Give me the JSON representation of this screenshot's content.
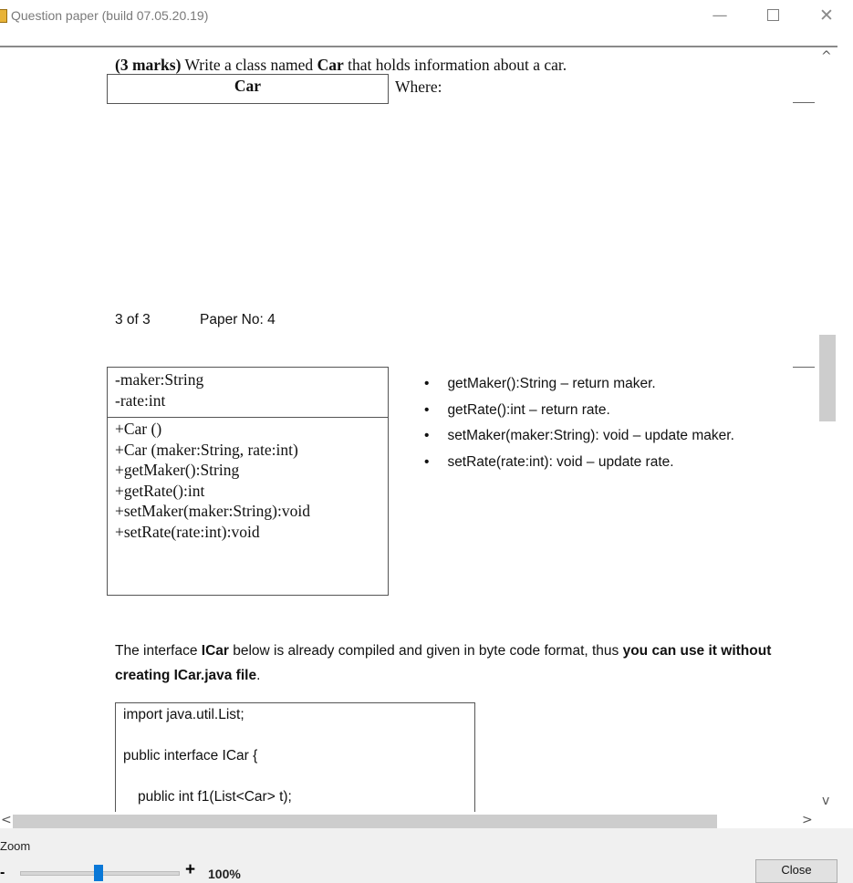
{
  "window": {
    "title": "Question paper (build 07.05.20.19)",
    "minimize": "—",
    "close": "✕"
  },
  "question": {
    "marks_bold": "(3 marks)",
    "intro_prefix": " Write a class named ",
    "class_bold": "Car",
    "intro_suffix": " that holds information about a car.",
    "where": "Where:"
  },
  "uml": {
    "class_name": "Car",
    "fields": [
      "-maker:String",
      "-rate:int"
    ],
    "methods": [
      "+Car ()",
      "+Car (maker:String, rate:int)",
      "+getMaker():String",
      "+getRate():int",
      "+setMaker(maker:String):void",
      "+setRate(rate:int):void"
    ]
  },
  "page_footer": {
    "page": "3 of 3",
    "paper": "Paper No: 4"
  },
  "bullets": [
    "getMaker():String – return maker.",
    "getRate():int – return rate.",
    "setMaker(maker:String): void – update maker.",
    "setRate(rate:int): void – update rate."
  ],
  "interface_text": {
    "p1": "The interface ",
    "b1": "ICar",
    "p2": " below is already compiled and given in byte code format, thus ",
    "b2": "you can use it without",
    "b3": "creating ICar.java file",
    "p3": "."
  },
  "code": [
    "import java.util.List;",
    "public interface ICar {",
    "public int f1(List<Car> t);"
  ],
  "scroll": {
    "up": "^",
    "down": "v",
    "left": "<",
    "right": ">"
  },
  "zoom": {
    "label": "Zoom",
    "minus": "-",
    "plus": "+",
    "value": "100%",
    "level": 0.5
  },
  "buttons": {
    "close": "Close"
  }
}
